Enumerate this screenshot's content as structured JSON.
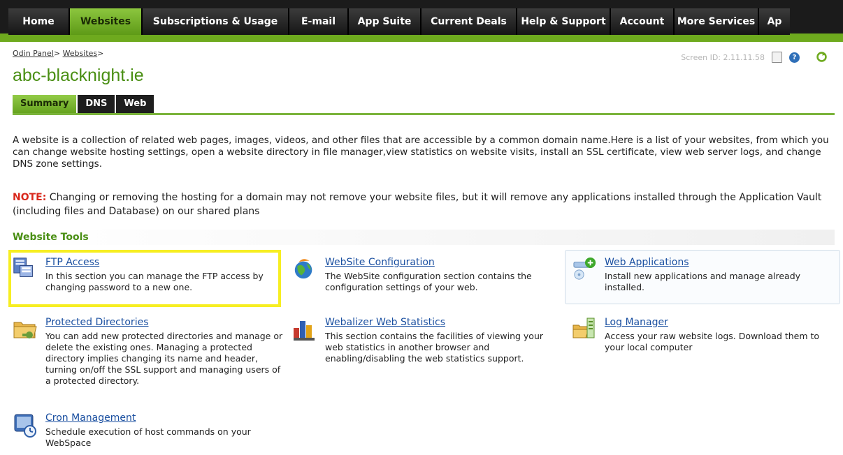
{
  "nav": {
    "tabs": [
      {
        "label": "Home",
        "width": 88,
        "active": false
      },
      {
        "label": "Websites",
        "width": 104,
        "active": true
      },
      {
        "label": "Subscriptions & Usage",
        "width": 210,
        "active": false
      },
      {
        "label": "E-mail",
        "width": 85,
        "active": false
      },
      {
        "label": "App Suite",
        "width": 104,
        "active": false
      },
      {
        "label": "Current Deals",
        "width": 137,
        "active": false
      },
      {
        "label": "Help & Support",
        "width": 134,
        "active": false
      },
      {
        "label": "Account",
        "width": 91,
        "active": false
      },
      {
        "label": "More Services",
        "width": 121,
        "active": false
      },
      {
        "label": "Ap",
        "width": 44,
        "active": false
      }
    ]
  },
  "breadcrumb": {
    "items": [
      "Odin Panel",
      "Websites"
    ],
    "sep": ">"
  },
  "header": {
    "screen_id": "Screen ID: 2.11.11.58",
    "title": "abc-blacknight.ie"
  },
  "subtabs": [
    {
      "label": "Summary",
      "active": true
    },
    {
      "label": "DNS",
      "active": false
    },
    {
      "label": "Web",
      "active": false
    }
  ],
  "intro": "A website is a collection of related web pages, images, videos, and other files that are accessible by a common domain name.Here is a list of your websites, from which you can change website hosting settings, open a website directory in file manager,view statistics on website visits, install an SSL certificate, view web server logs, and change DNS zone settings.",
  "note": {
    "label": "NOTE:",
    "text": " Changing or removing the hosting for a domain may not remove your website files, but it will remove any applications installed through the Application Vault (including files and Database) on our shared plans"
  },
  "tools": {
    "heading": "Website Tools",
    "items": [
      {
        "key": "ftp",
        "title": "FTP Access",
        "desc": "In this section you can manage the FTP access by changing password to a new one."
      },
      {
        "key": "config",
        "title": "WebSite Configuration",
        "desc": "The WebSite configuration section contains the configuration settings of your web."
      },
      {
        "key": "apps",
        "title": "Web Applications",
        "desc": "Install new applications and manage already installed."
      },
      {
        "key": "protected",
        "title": "Protected Directories",
        "desc": "You can add new protected directories and manage or delete the existing ones. Managing a protected directory implies changing its name and header, turning on/off the SSL support and managing users of a protected directory."
      },
      {
        "key": "webalizer",
        "title": "Webalizer Web Statistics",
        "desc": "This section contains the facilities of viewing your web statistics in another browser and enabling/disabling the web statistics support."
      },
      {
        "key": "logs",
        "title": "Log Manager",
        "desc": "Access your raw website logs. Download them to your local computer"
      },
      {
        "key": "cron",
        "title": "Cron Management",
        "desc": "Schedule execution of host commands on your WebSpace"
      }
    ]
  },
  "colors": {
    "nav_active": "#6eaa1e",
    "title_green": "#4a8f14",
    "link_blue": "#1a4fa0",
    "note_red": "#d9281c",
    "highlight": "#f7ee22"
  }
}
